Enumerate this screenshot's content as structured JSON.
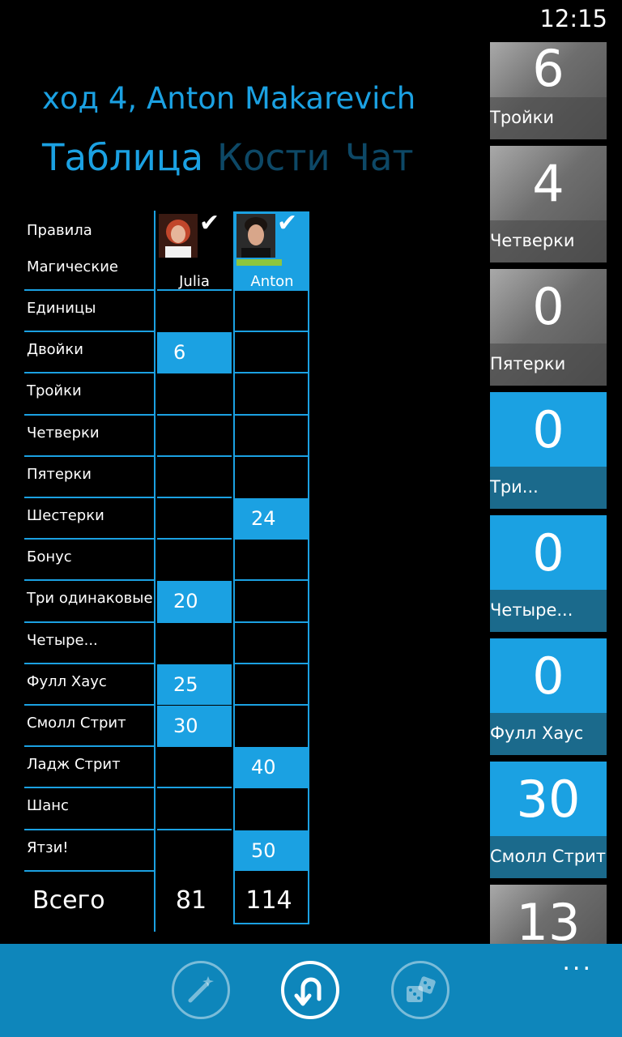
{
  "status": {
    "time": "12:15"
  },
  "header": {
    "title": "ход 4, Anton Makarevich"
  },
  "pivots": [
    "Таблица",
    "Кости",
    "Чат"
  ],
  "table": {
    "header_labels": [
      "Правила",
      "Магические"
    ],
    "players": [
      {
        "name": "Julia",
        "checked": true
      },
      {
        "name": "Anton",
        "checked": true,
        "active": true
      }
    ],
    "rows": [
      {
        "label": "Единицы",
        "julia": "",
        "anton": ""
      },
      {
        "label": "Двойки",
        "julia": "6",
        "anton": ""
      },
      {
        "label": "Тройки",
        "julia": "",
        "anton": ""
      },
      {
        "label": "Четверки",
        "julia": "",
        "anton": ""
      },
      {
        "label": "Пятерки",
        "julia": "",
        "anton": ""
      },
      {
        "label": "Шестерки",
        "julia": "",
        "anton": "24"
      },
      {
        "label": "Бонус",
        "julia": "",
        "anton": ""
      },
      {
        "label": "Три одинаковые",
        "julia": "20",
        "anton": ""
      },
      {
        "label": "Четыре...",
        "julia": "",
        "anton": ""
      },
      {
        "label": "Фулл Хаус",
        "julia": "25",
        "anton": ""
      },
      {
        "label": "Смолл Стрит",
        "julia": "30",
        "anton": ""
      },
      {
        "label": "Ладж Стрит",
        "julia": "",
        "anton": "40"
      },
      {
        "label": "Шанс",
        "julia": "",
        "anton": ""
      },
      {
        "label": "Ятзи!",
        "julia": "",
        "anton": "50"
      }
    ],
    "total_label": "Всего",
    "totals": {
      "julia": "81",
      "anton": "114"
    }
  },
  "tiles": [
    {
      "value": "6",
      "label": "Тройки",
      "style": "gray"
    },
    {
      "value": "4",
      "label": "Четверки",
      "style": "gray"
    },
    {
      "value": "0",
      "label": "Пятерки",
      "style": "gray"
    },
    {
      "value": "0",
      "label": "Три...",
      "style": "blue"
    },
    {
      "value": "0",
      "label": "Четыре...",
      "style": "blue"
    },
    {
      "value": "0",
      "label": "Фулл Хаус",
      "style": "blue"
    },
    {
      "value": "30",
      "label": "Смолл Стрит",
      "style": "blue"
    },
    {
      "value": "13",
      "label": "",
      "style": "gray"
    }
  ],
  "appbar": {
    "buttons": [
      "magic-wand-icon",
      "undo-icon",
      "dice-icon"
    ],
    "more": "..."
  },
  "colors": {
    "accent": "#1ba1e2",
    "appbar": "#0e86bb",
    "tile_label_blue": "#1b6a8c"
  }
}
